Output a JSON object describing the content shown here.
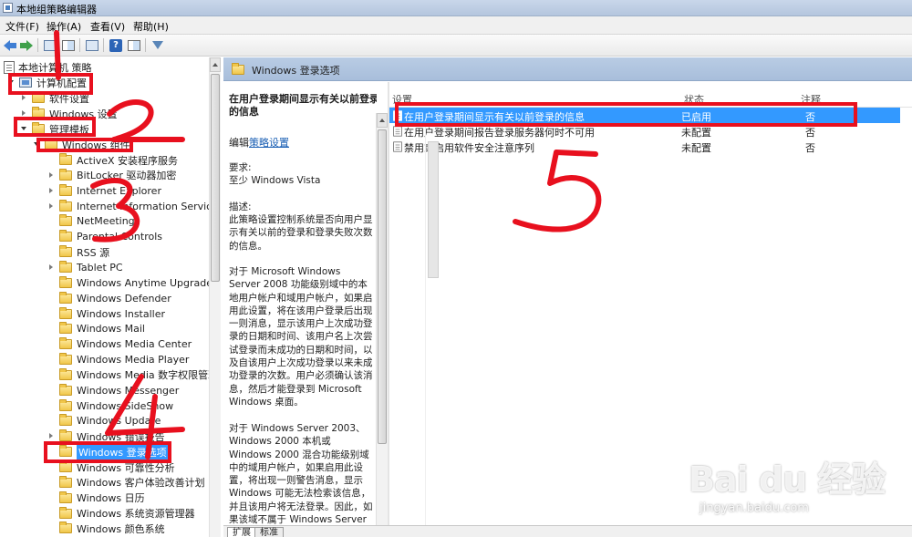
{
  "window": {
    "title": "本地组策略编辑器"
  },
  "menu": [
    "文件(F)",
    "操作(A)",
    "查看(V)",
    "帮助(H)"
  ],
  "toolbar": {
    "buttons": [
      "back-icon",
      "forward-icon",
      "up-folder-icon",
      "show-tree-icon",
      "export-icon",
      "help-icon",
      "properties-icon",
      "filter-icon"
    ]
  },
  "tree": {
    "root": "本地计算机 策略",
    "computer_config": "计算机配置",
    "software_settings": "软件设置",
    "windows_settings": "Windows 设置",
    "admin_templates": "管理模板",
    "windows_components": "Windows 组件",
    "items": [
      "ActiveX 安装程序服务",
      "BitLocker 驱动器加密",
      "Internet Explorer",
      "Internet Information Services",
      "NetMeeting",
      "Parental Controls",
      "RSS 源",
      "Tablet PC",
      "Windows Anytime Upgrade",
      "Windows Defender",
      "Windows Installer",
      "Windows Mail",
      "Windows Media Center",
      "Windows Media Player",
      "Windows Media 数字权限管理",
      "Windows Messenger",
      "Windows SideShow",
      "Windows Update",
      "Windows 错误报告",
      "Windows 登录选项",
      "Windows 可靠性分析",
      "Windows 客户体验改善计划",
      "Windows 日历",
      "Windows 系统资源管理器",
      "Windows 颜色系统"
    ],
    "selected": "Windows 登录选项"
  },
  "header": {
    "title": "Windows 登录选项"
  },
  "description": {
    "title": "在用户登录期间显示有关以前登录的信息",
    "edit_prefix": "编辑",
    "edit_link": "策略设置",
    "requirements_label": "要求:",
    "requirements_value": "至少 Windows Vista",
    "desc_label": "描述:",
    "desc_text": "此策略设置控制系统是否向用户显示有关以前的登录和登录失败次数的信息。",
    "para1": "对于 Microsoft Windows Server 2008 功能级别域中的本地用户帐户和域用户帐户，如果启用此设置，将在该用户登录后出现一则消息，显示该用户上次成功登录的日期和时间、该用户名上次尝试登录而未成功的日期和时间，以及自该用户上次成功登录以来未成功登录的次数。用户必须确认该消息，然后才能登录到 Microsoft Windows 桌面。",
    "para2": "对于 Windows Server 2003、Windows 2000 本机或 Windows 2000 混合功能级别域中的域用户帐户，如果启用此设置，将出现一则警告消息，显示 Windows 可能无法检索该信息，并且该用户将无法登录。因此，如果该域不属于 Windows Server"
  },
  "list": {
    "columns": {
      "setting": "设置",
      "state": "状态",
      "comment": "注释"
    },
    "rows": [
      {
        "setting": "在用户登录期间显示有关以前登录的信息",
        "state": "已启用",
        "comment": "否"
      },
      {
        "setting": "在用户登录期间报告登录服务器何时不可用",
        "state": "未配置",
        "comment": "否"
      },
      {
        "setting": "禁用或启用软件安全注意序列",
        "state": "未配置",
        "comment": "否"
      }
    ]
  },
  "tabs": {
    "extended": "扩展",
    "standard": "标准"
  },
  "watermark": {
    "logo": "Bai du 经验",
    "url": "jingyan.baidu.com"
  },
  "annotation_color": "#e8101e",
  "selection_color": "#3399ff"
}
